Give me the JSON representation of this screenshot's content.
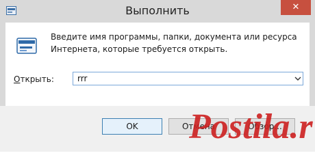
{
  "window": {
    "title": "Выполнить",
    "close_glyph": "✕"
  },
  "content": {
    "icon": "run-icon",
    "description": "Введите имя программы, папки, документа или ресурса Интернета, которые требуется открыть.",
    "open_label_underline": "О",
    "open_label_rest": "ткрыть:",
    "combo_value": "rrr"
  },
  "buttons": {
    "ok": "OK",
    "cancel": "Отмена",
    "browse": "Обзор..."
  },
  "colors": {
    "close": "#c7503f",
    "accent": "#3c7fb1",
    "watermark": "#cc1f1f"
  },
  "watermark": "Postila.ru"
}
